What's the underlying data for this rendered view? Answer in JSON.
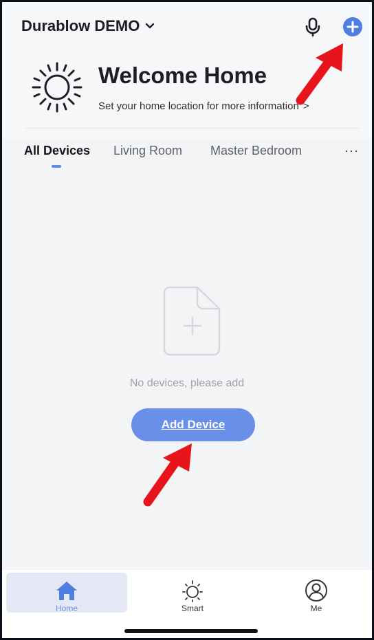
{
  "header": {
    "home_name": "Durablow DEMO",
    "icons": {
      "home_dropdown": "chevron-down-icon",
      "voice": "microphone-icon",
      "add": "plus-circle-icon"
    },
    "accent_color": "#4f7de0"
  },
  "welcome": {
    "title": "Welcome Home",
    "subtitle": "Set your home location for more information",
    "subtitle_chevron": ">",
    "icon": "sun-icon"
  },
  "tabs": {
    "items": [
      {
        "label": "All Devices",
        "active": true
      },
      {
        "label": "Living Room",
        "active": false
      },
      {
        "label": "Master Bedroom",
        "active": false
      }
    ],
    "more_label": "···"
  },
  "empty_state": {
    "icon": "document-plus-icon",
    "message": "No devices, please add",
    "button_label": "Add Device",
    "button_color": "#6a8fe9"
  },
  "annotations": {
    "arrow_color": "#e8141b"
  },
  "tabbar": {
    "items": [
      {
        "label": "Home",
        "icon": "home-icon",
        "active": true
      },
      {
        "label": "Smart",
        "icon": "sun-icon",
        "active": false
      },
      {
        "label": "Me",
        "icon": "user-circle-icon",
        "active": false
      }
    ]
  }
}
